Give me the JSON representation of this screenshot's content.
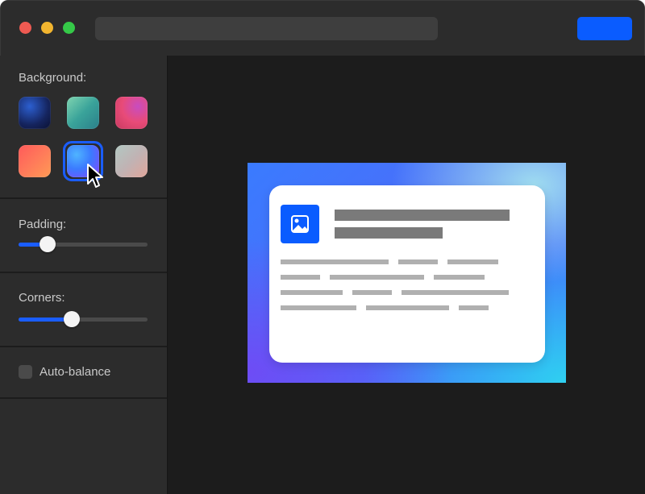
{
  "window": {
    "traffic_lights": [
      "close",
      "minimize",
      "zoom"
    ],
    "url_bar": "",
    "action_button_color": "#0a5cff"
  },
  "sidebar": {
    "background": {
      "label": "Background:",
      "swatches": [
        {
          "name": "deep-blue"
        },
        {
          "name": "teal-green"
        },
        {
          "name": "magenta-pink"
        },
        {
          "name": "coral-orange"
        },
        {
          "name": "blue-violet",
          "selected": true
        },
        {
          "name": "sage-peach"
        }
      ]
    },
    "padding": {
      "label": "Padding:",
      "value_fraction": 0.22
    },
    "corners": {
      "label": "Corners:",
      "value_fraction": 0.41
    },
    "auto_balance": {
      "label": "Auto-balance",
      "checked": false
    }
  },
  "preview": {
    "card_icon": "image-icon",
    "accent": "#0a5cff"
  }
}
